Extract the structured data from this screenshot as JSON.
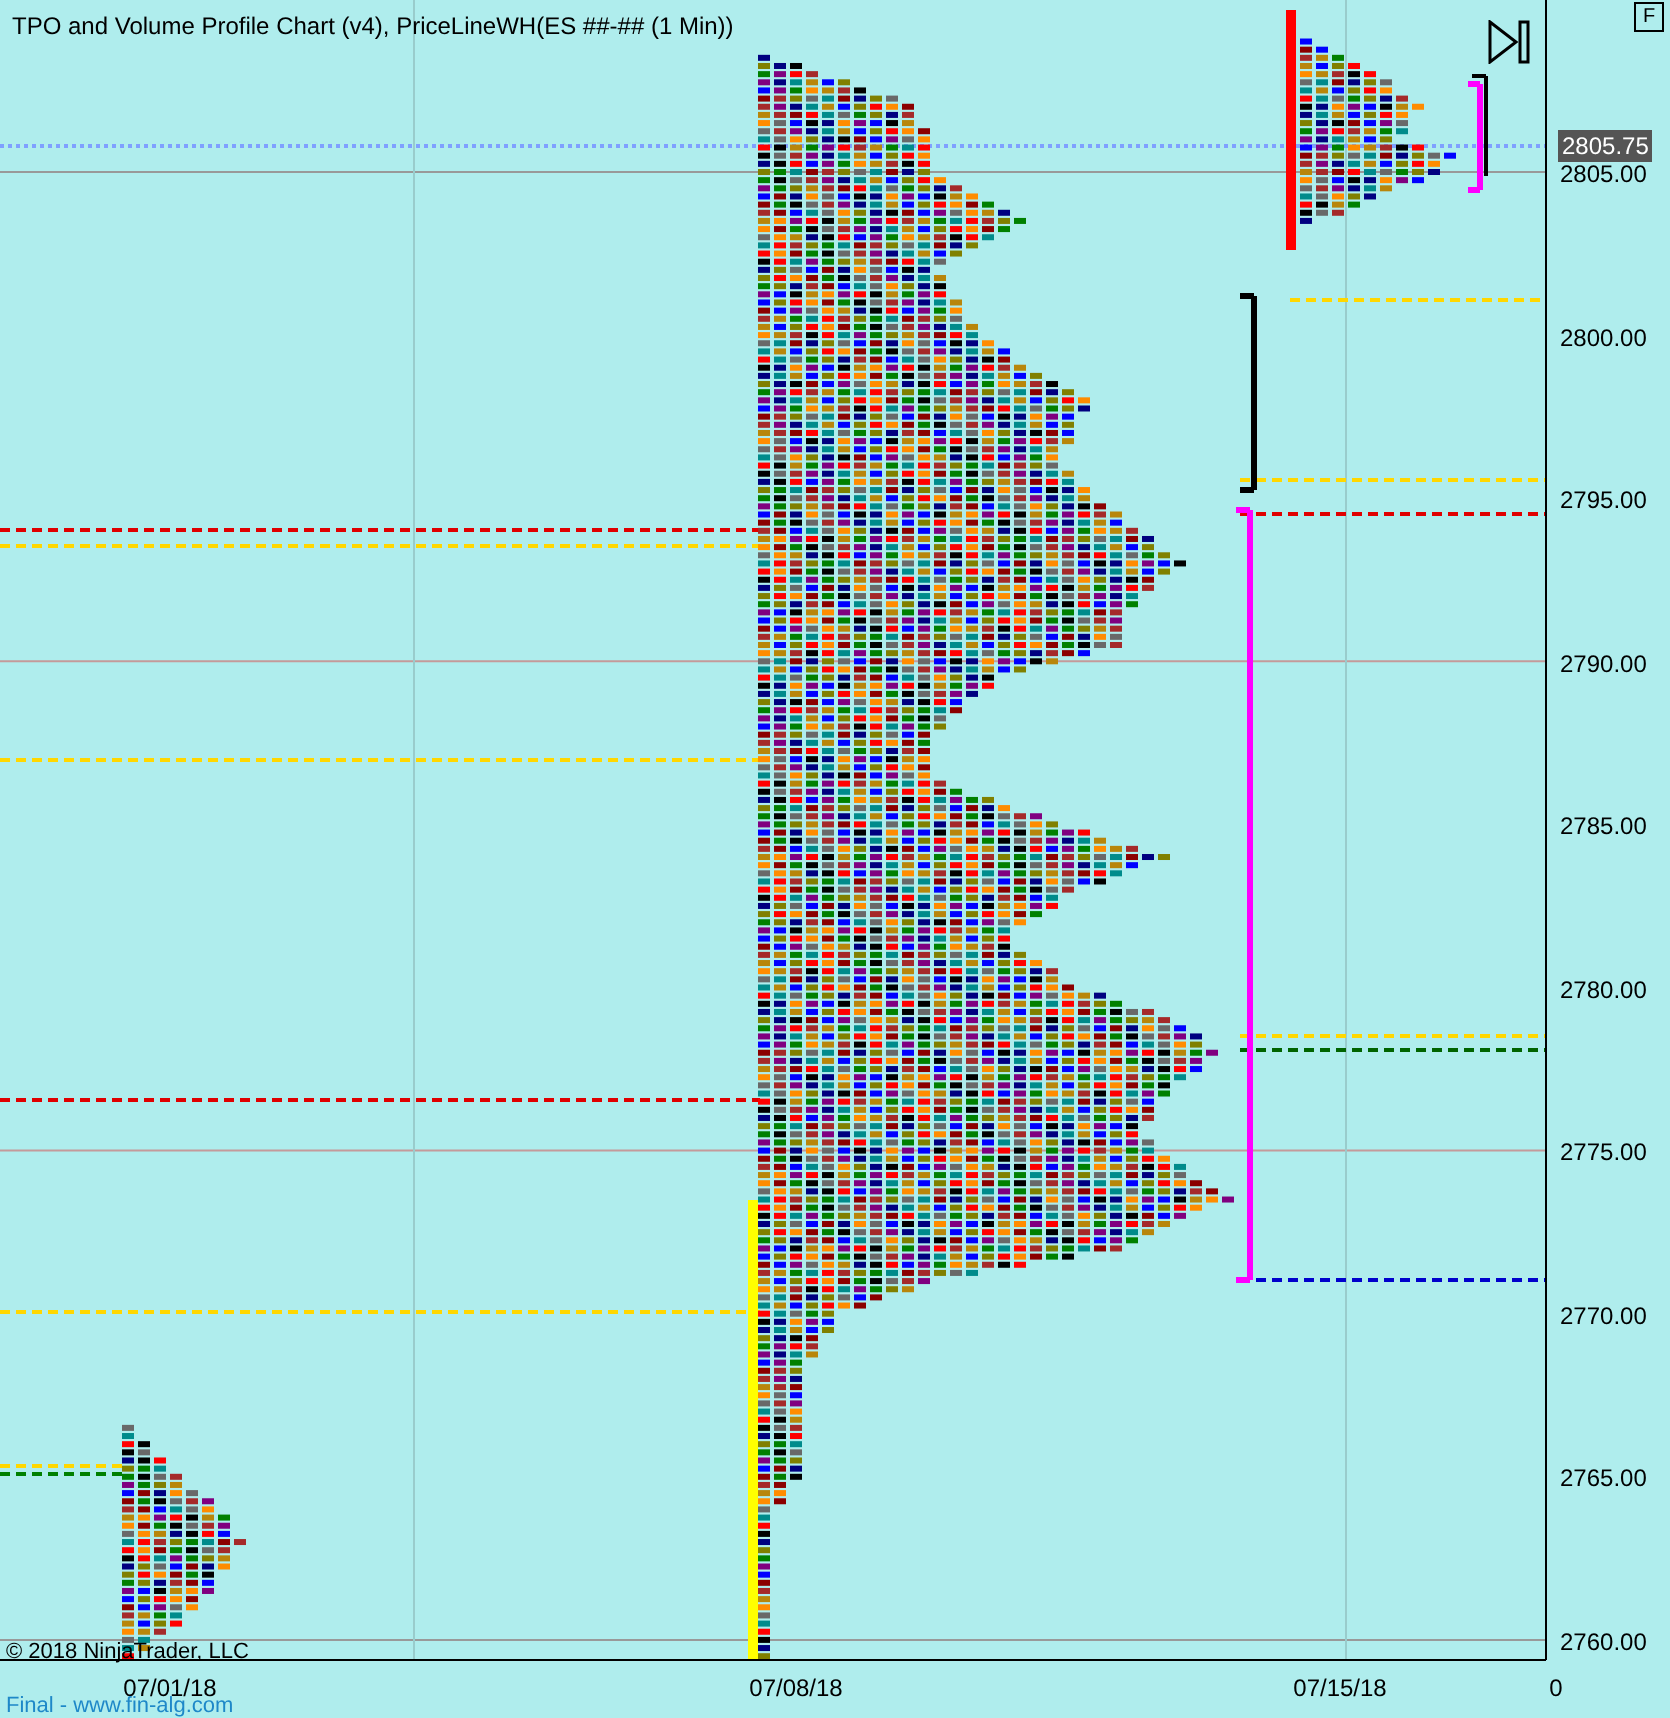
{
  "title": "TPO and Volume Profile Chart (v4), PriceLineWH(ES ##-## (1 Min))",
  "corner_button": "F",
  "price_axis": {
    "labels": [
      "2805.00",
      "2800.00",
      "2795.00",
      "2790.00",
      "2785.00",
      "2780.00",
      "2775.00",
      "2770.00",
      "2765.00",
      "2760.00"
    ]
  },
  "last_price": "2805.75",
  "date_axis": {
    "labels": [
      "07/01/18",
      "07/08/18",
      "07/15/18",
      "0"
    ]
  },
  "copyright": "© 2018 NinjaTrader, LLC",
  "footer_link": "Final - www.fin-alg.com"
}
